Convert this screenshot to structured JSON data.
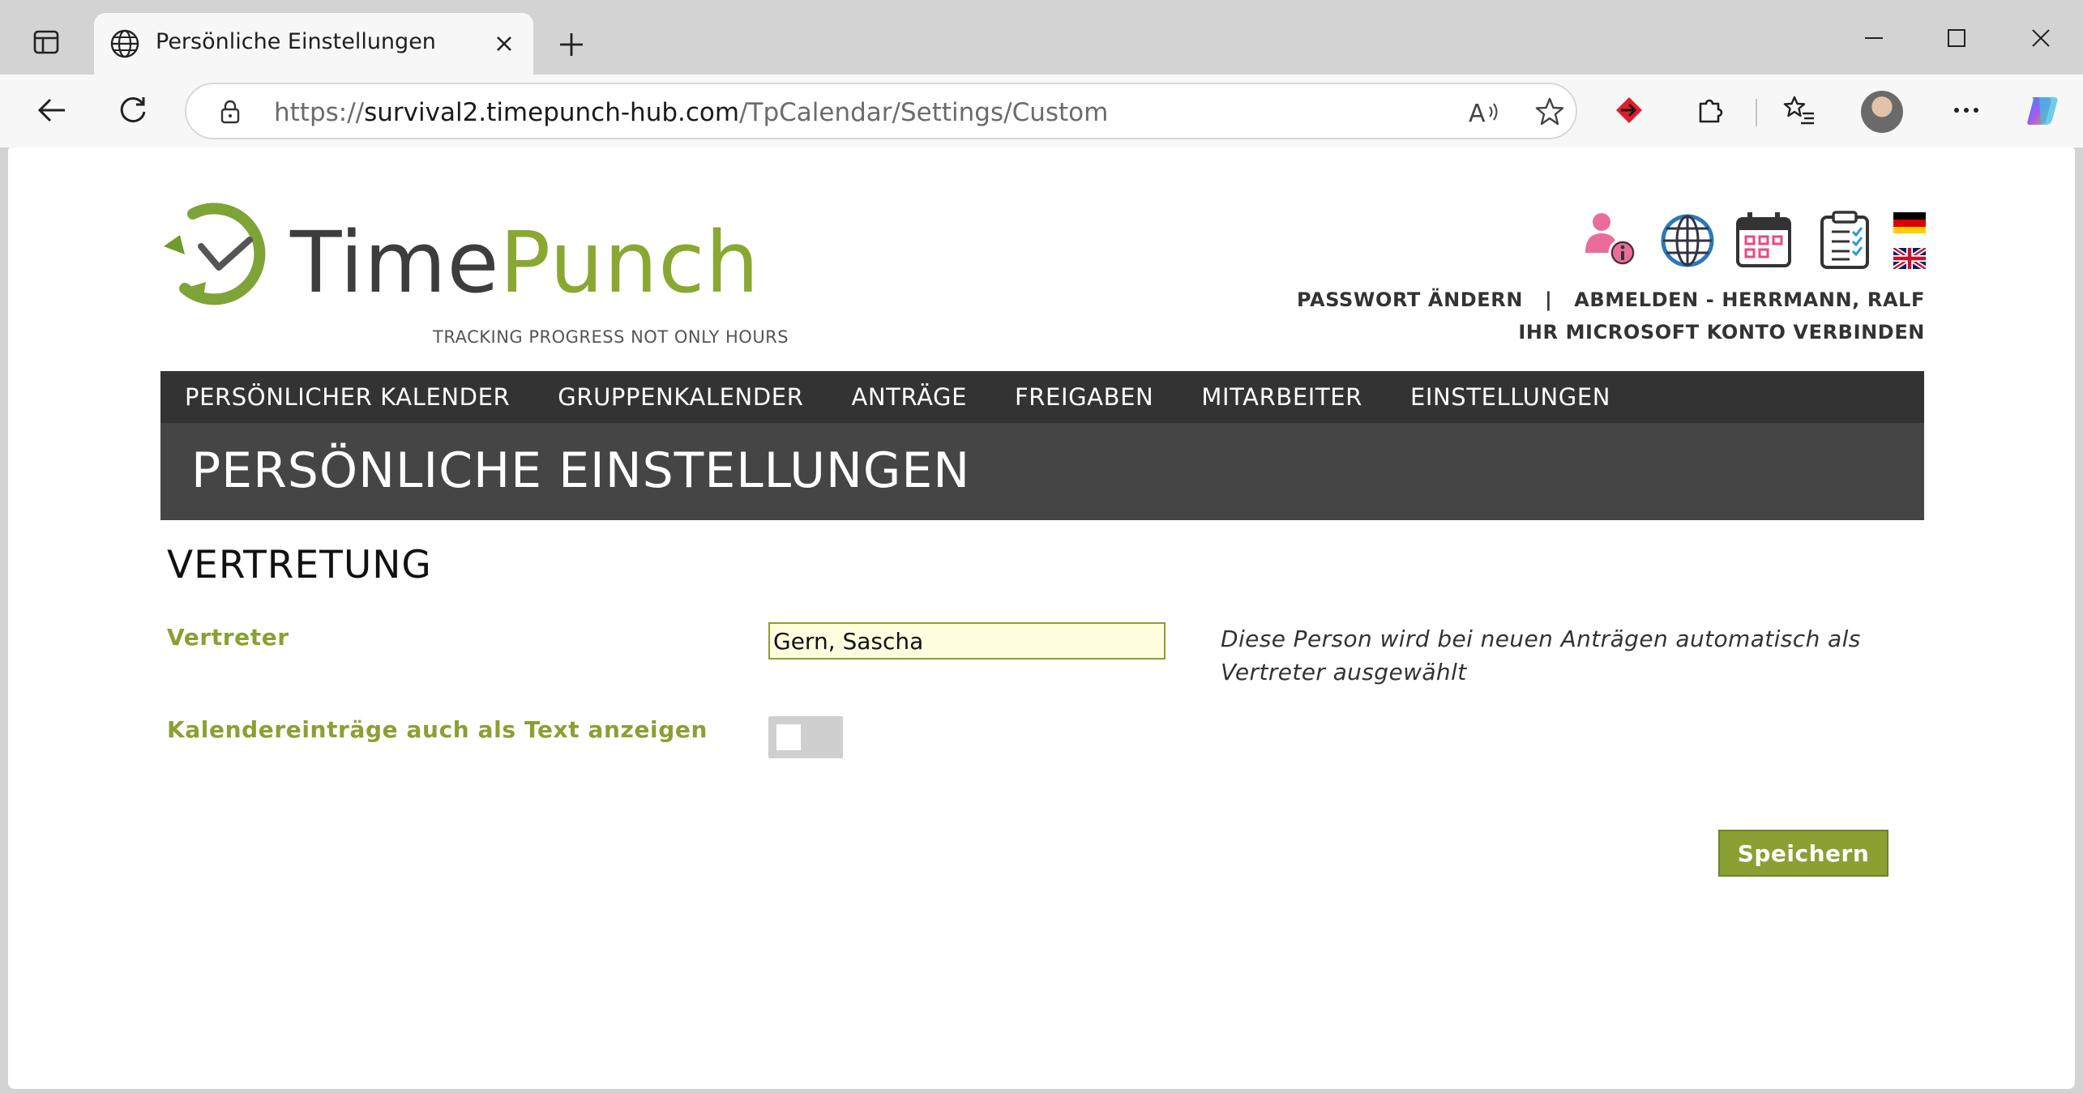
{
  "browser": {
    "tab_title": "Persönliche Einstellungen",
    "url_scheme": "https://",
    "url_host": "survival2.timepunch-hub.com",
    "url_path": "/TpCalendar/Settings/Custom"
  },
  "header": {
    "logo_word_1": "Time",
    "logo_word_2": "Punch",
    "logo_tagline": "TRACKING PROGRESS NOT ONLY HOURS",
    "change_password": "PASSWORT ÄNDERN",
    "separator": "|",
    "logout": "ABMELDEN - HERRMANN, RALF",
    "connect_microsoft": "IHR MICROSOFT KONTO VERBINDEN"
  },
  "nav": {
    "items": [
      "PERSÖNLICHER KALENDER",
      "GRUPPENKALENDER",
      "ANTRÄGE",
      "FREIGABEN",
      "MITARBEITER",
      "EINSTELLUNGEN"
    ]
  },
  "page": {
    "title": "PERSÖNLICHE EINSTELLUNGEN",
    "section_title": "VERTRETUNG"
  },
  "form": {
    "representative_label": "Vertreter",
    "representative_value": "Gern, Sascha",
    "representative_hint": "Diese Person wird bei neuen Anträgen automatisch als Vertreter ausgewählt",
    "calendar_text_label": "Kalendereinträge auch als Text anzeigen",
    "calendar_text_enabled": false,
    "save_label": "Speichern"
  },
  "colors": {
    "brand_green": "#8aa033",
    "nav_dark": "#333333",
    "banner_dark": "#454545"
  }
}
